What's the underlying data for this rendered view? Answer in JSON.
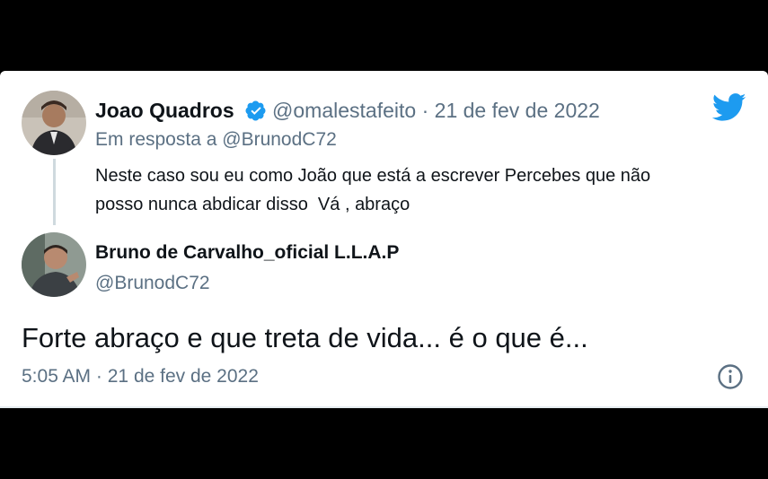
{
  "reply_tweet": {
    "display_name": "Joao Quadros",
    "handle": "@omalestafeito",
    "separator": "·",
    "date": "21 de fev de 2022",
    "reply_prefix": "Em resposta a",
    "reply_handle": "@BrunodC72",
    "text_line1": "Neste caso sou eu como João que está a escrever Percebes que não",
    "text_line2": "posso nunca abdicar disso  Vá , abraço",
    "avatar_icon": "avatar",
    "verified_icon": "verified-badge-icon"
  },
  "main_tweet": {
    "display_name": "Bruno de Carvalho_oficial L.L.A.P",
    "handle": "@BrunodC72",
    "text": "Forte abraço e que treta de vida... é o que é...",
    "time": "5:05 AM",
    "separator": "·",
    "date": "21 de fev de 2022",
    "info_icon": "info-icon"
  },
  "brand": {
    "logo_icon": "twitter-bird-icon",
    "accent_color": "#1d9bf0"
  }
}
